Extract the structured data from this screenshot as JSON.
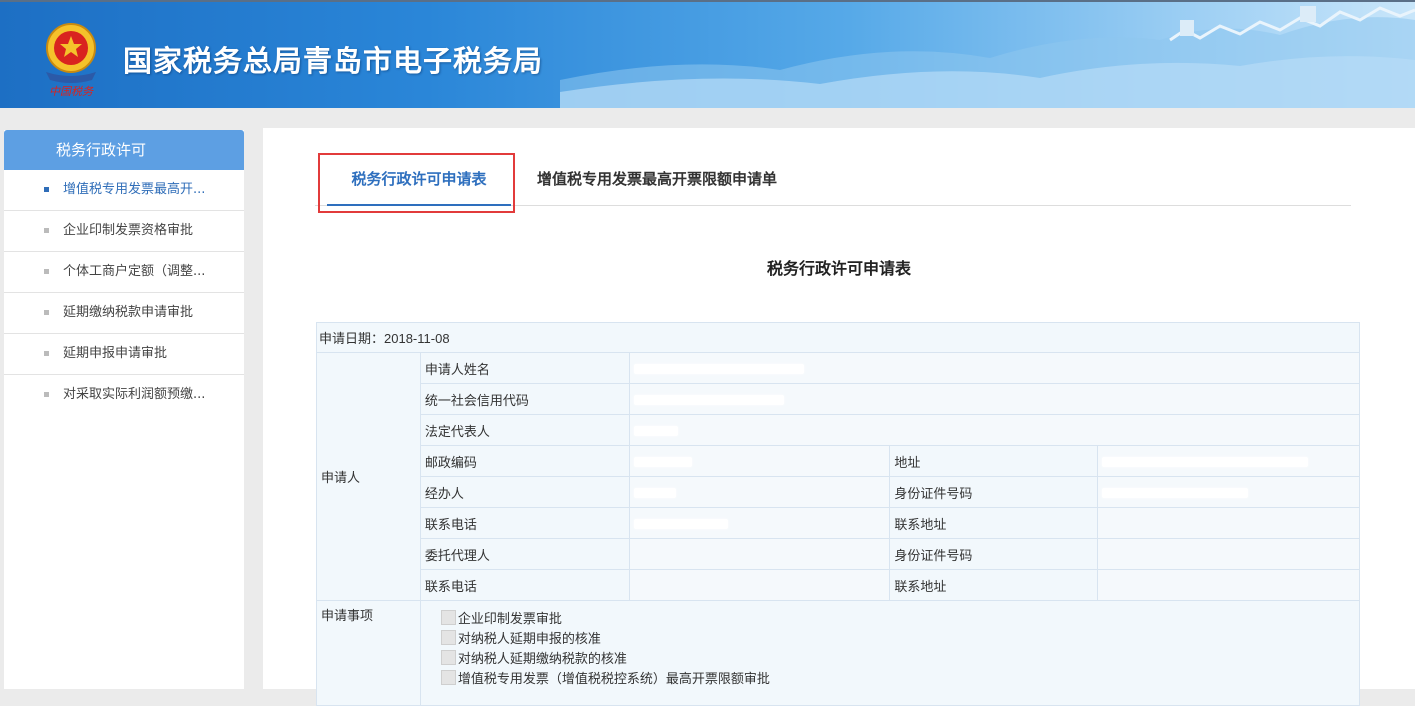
{
  "header": {
    "site_title": "国家税务总局青岛市电子税务局",
    "emblem_caption": "中国税务"
  },
  "sidebar": {
    "title": "税务行政许可",
    "items": [
      {
        "label": "增值税专用发票最高开...",
        "active": true
      },
      {
        "label": "企业印制发票资格审批",
        "active": false
      },
      {
        "label": "个体工商户定额（调整...",
        "active": false
      },
      {
        "label": "延期缴纳税款申请审批",
        "active": false
      },
      {
        "label": "延期申报申请审批",
        "active": false
      },
      {
        "label": "对采取实际利润额预缴...",
        "active": false
      }
    ]
  },
  "tabs": {
    "items": [
      {
        "label": "税务行政许可申请表",
        "active": true
      },
      {
        "label": "增值税专用发票最高开票限额申请单",
        "active": false
      }
    ]
  },
  "form": {
    "title": "税务行政许可申请表",
    "apply_date_label": "申请日期：",
    "apply_date": "2018-11-08",
    "applicant_label": "申请人",
    "fields": {
      "name": "申请人姓名",
      "credit_code": "统一社会信用代码",
      "legal_rep": "法定代表人",
      "postcode": "邮政编码",
      "address": "地址",
      "handler": "经办人",
      "id_number": "身份证件号码",
      "phone": "联系电话",
      "contact_address": "联系地址",
      "agent": "委托代理人",
      "agent_id_number": "身份证件号码",
      "agent_phone": "联系电话",
      "agent_contact_address": "联系地址"
    },
    "matter_label": "申请事项",
    "matters": [
      "企业印制发票审批",
      "对纳税人延期申报的核准",
      "对纳税人延期缴纳税款的核准",
      "增值税专用发票（增值税税控系统）最高开票限额审批"
    ]
  },
  "colors": {
    "accent": "#2e6fbe",
    "sidebar_header": "#5d9fe3",
    "highlight_border": "#e23b3b",
    "table_border": "#d8e4f0",
    "table_bg": "#f2f8fc"
  }
}
